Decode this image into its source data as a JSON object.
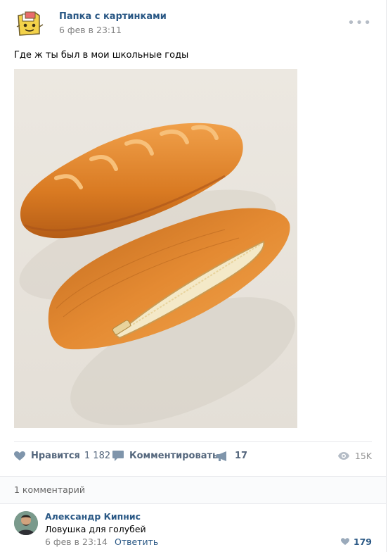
{
  "post": {
    "author": "Папка с картинками",
    "date": "6 фев в 23:11",
    "text": "Где ж ты был в мои школьные годы",
    "more_label": "•••"
  },
  "actions": {
    "like_label": "Нравится",
    "like_count": "1 182",
    "comment_label": "Комментировать",
    "share_count": "17",
    "views": "15K"
  },
  "comments": {
    "count_label": "1 комментарий",
    "items": [
      {
        "author": "Александр Кипнис",
        "text": "Ловушка для голубей",
        "date": "6 фев в 23:14",
        "reply_label": "Ответить",
        "likes": "179"
      }
    ]
  },
  "colors": {
    "link": "#2a5885",
    "action_gray": "#55677d",
    "photo_bg": "#e8e4dd",
    "bread": "#d9802a"
  }
}
